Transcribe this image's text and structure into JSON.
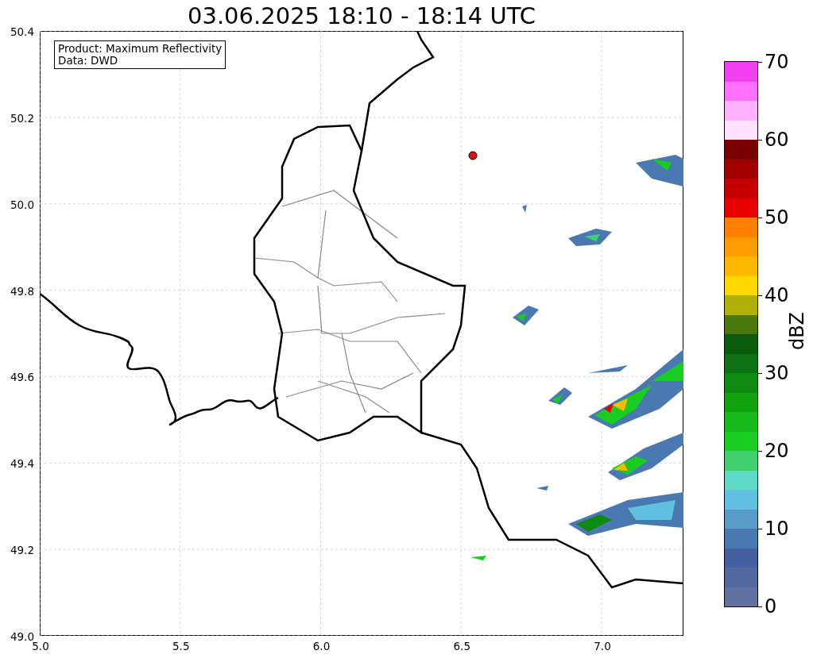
{
  "title": "03.06.2025 18:10 - 18:14 UTC",
  "info_box": [
    "Product: Maximum Reflectivity",
    "Data: DWD"
  ],
  "axes": {
    "xticks": [
      "5.0",
      "5.5",
      "6.0",
      "6.5",
      "7.0"
    ],
    "yticks": [
      "50.4",
      "50.2",
      "50.0",
      "49.8",
      "49.6",
      "49.4",
      "49.2",
      "49.0"
    ]
  },
  "colorbar": {
    "label": "dBZ",
    "ticks": [
      "70",
      "60",
      "50",
      "40",
      "30",
      "20",
      "10",
      "0"
    ],
    "segments": [
      {
        "color": "#6070a0"
      },
      {
        "color": "#5468a0"
      },
      {
        "color": "#4460a0"
      },
      {
        "color": "#4a78b0"
      },
      {
        "color": "#5a9cc8"
      },
      {
        "color": "#60c0e0"
      },
      {
        "color": "#60d8c8"
      },
      {
        "color": "#40d070"
      },
      {
        "color": "#18cc20"
      },
      {
        "color": "#14b818"
      },
      {
        "color": "#10a010"
      },
      {
        "color": "#0e8a12"
      },
      {
        "color": "#0c7014"
      },
      {
        "color": "#0a5a0e"
      },
      {
        "color": "#4a780c"
      },
      {
        "color": "#b0b008"
      },
      {
        "color": "#ffd800"
      },
      {
        "color": "#ffb800"
      },
      {
        "color": "#ff9c00"
      },
      {
        "color": "#ff8000"
      },
      {
        "color": "#e60000"
      },
      {
        "color": "#c40000"
      },
      {
        "color": "#a00000"
      },
      {
        "color": "#780000"
      },
      {
        "color": "#ffe0ff"
      },
      {
        "color": "#ffb0ff"
      },
      {
        "color": "#ff70ff"
      },
      {
        "color": "#f040f0"
      }
    ]
  }
}
